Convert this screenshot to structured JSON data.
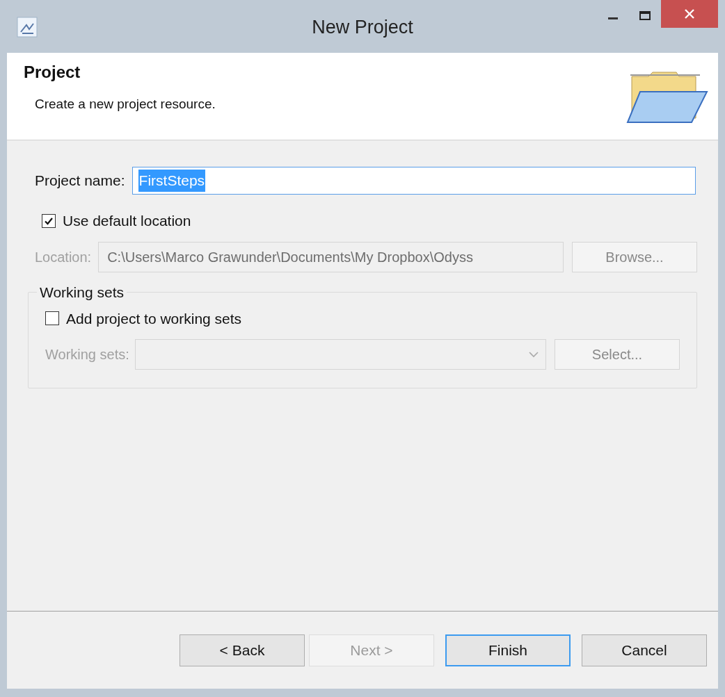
{
  "window": {
    "title": "New Project"
  },
  "header": {
    "title": "Project",
    "description": "Create a new project resource."
  },
  "project_name": {
    "label": "Project name:",
    "value": "FirstSteps"
  },
  "use_default_location": {
    "label": "Use default location",
    "checked": true
  },
  "location": {
    "label": "Location:",
    "value": "C:\\Users\\Marco Grawunder\\Documents\\My Dropbox\\Odyss",
    "disabled": true,
    "button": "Browse..."
  },
  "working_sets_group": {
    "title": "Working sets",
    "add_checkbox": {
      "label": "Add project to working sets",
      "checked": false
    },
    "label": "Working sets:",
    "disabled": true,
    "button": "Select..."
  },
  "buttons": [
    {
      "label": "< Back",
      "disabled": false,
      "default": false
    },
    {
      "label": "Next >",
      "disabled": true,
      "default": false
    },
    {
      "label": "Finish",
      "disabled": false,
      "default": true
    },
    {
      "label": "Cancel",
      "disabled": false,
      "default": false
    }
  ]
}
